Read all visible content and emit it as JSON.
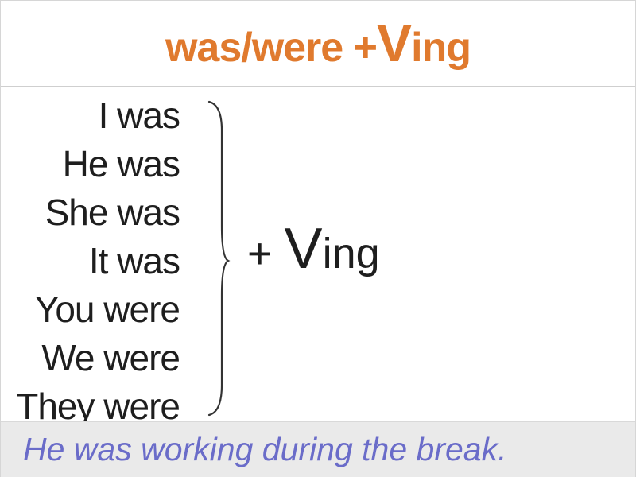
{
  "title": {
    "prefix": "was/were +",
    "v_letter": "V",
    "suffix": "ing"
  },
  "pronouns": [
    "I was",
    "He was",
    "She was",
    "It was",
    "You were",
    "We were",
    "They were"
  ],
  "formula": {
    "prefix": "+ ",
    "v_letter": "V",
    "suffix": "ing"
  },
  "example": "He was working during the break.",
  "colors": {
    "title": "#e07a2e",
    "text": "#1e1e1e",
    "example": "#6a6cc9",
    "example_background": "#eaeaea"
  }
}
